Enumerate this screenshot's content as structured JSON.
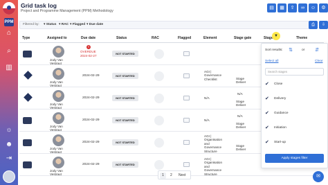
{
  "header": {
    "title": "Grid task log",
    "subtitle": "Project and Programme Management (PPM) Methodology"
  },
  "toolbar": {
    "icons": [
      "gantt-icon",
      "calendar-icon",
      "share-icon",
      "link-icon",
      "people-icon",
      "settings-icon"
    ]
  },
  "filters": {
    "label": "Filtered by:",
    "chips": [
      "Status",
      "RAC",
      "Flagged",
      "Due date"
    ]
  },
  "columns": [
    "Type",
    "Assigned to",
    "Due date",
    "Status",
    "RAC",
    "Flagged",
    "Element",
    "Stage gate",
    "Stage",
    "Theme"
  ],
  "rows": [
    {
      "type": "deliverable",
      "assignee": "Jody Van Vestraut",
      "due": "2024-02-27",
      "overdue_label": "OVERDUE",
      "status": "NOT STARTED",
      "element": "",
      "gate": "",
      "stage": ""
    },
    {
      "type": "milestone",
      "assignee": "Jody Van Vestraut",
      "due": "2024-02-29",
      "status": "NOT STARTED",
      "element": "AGI | Governance Checklist",
      "gate": "",
      "stage": "Stage Deliver"
    },
    {
      "type": "milestone",
      "assignee": "Jody Van Vestraut",
      "due": "2024-02-29",
      "status": "NOT STARTED",
      "element": "N/A",
      "gate": "N/A",
      "stage": "Stage Deliver"
    },
    {
      "type": "deliverable",
      "assignee": "Jody Van Vestraut",
      "due": "2024-02-29",
      "status": "NOT STARTED",
      "element": "N/A",
      "gate": "N/A",
      "stage": "Stage Deliver"
    },
    {
      "type": "deliverable",
      "assignee": "Jody Van Vestraut",
      "due": "2024-02-29",
      "status": "NOT STARTED",
      "element": "AGI | Organisation and Governance Structure",
      "gate": "",
      "stage": "Stage Deliver"
    },
    {
      "type": "deliverable",
      "assignee": "Jody Van Vestraut",
      "due": "2024-02-29",
      "status": "NOT STARTED",
      "element": "AGI | Organisation and Governance Structure",
      "gate": "",
      "stage": ""
    }
  ],
  "dropdown": {
    "sort_label": "Sort results:",
    "or_label": "or",
    "select_all": "Select all",
    "clear": "Clear",
    "search_placeholder": "Search stages",
    "items": [
      {
        "label": "Close",
        "checked": true
      },
      {
        "label": "Delivery",
        "checked": true
      },
      {
        "label": "Guidance",
        "checked": true
      },
      {
        "label": "Initiation",
        "checked": true
      },
      {
        "label": "Start-up",
        "checked": true
      }
    ],
    "apply": "Apply stages filter"
  },
  "pagination": {
    "current": "1",
    "next_page": "2",
    "next_label": "Next"
  },
  "colors": {
    "accent": "#2f6fd6",
    "overdue": "#d63030",
    "filter_active": "#ffe84a"
  }
}
